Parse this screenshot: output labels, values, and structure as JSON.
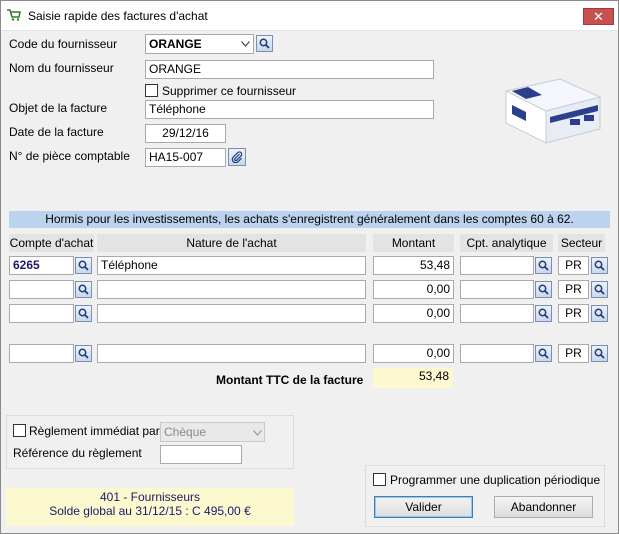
{
  "window": {
    "title": "Saisie rapide des factures d'achat",
    "close": "✕"
  },
  "form": {
    "supplier_code_label": "Code du fournisseur",
    "supplier_code_value": "ORANGE",
    "supplier_name_label": "Nom du fournisseur",
    "supplier_name_value": "ORANGE",
    "delete_supplier_label": "Supprimer ce fournisseur",
    "invoice_object_label": "Objet de la facture",
    "invoice_object_value": "Téléphone",
    "invoice_date_label": "Date de la facture",
    "invoice_date_value": "29/12/16",
    "piece_label": "N° de pièce comptable",
    "piece_value": "HA15-007"
  },
  "info_bar": "Hormis pour les investissements, les achats s'enregistrent généralement dans les comptes 60 à 62.",
  "table": {
    "headers": [
      "Compte d'achat",
      "Nature de l'achat",
      "Montant",
      "Cpt. analytique",
      "Secteur"
    ],
    "rows": [
      {
        "account": "6265",
        "nature": "Téléphone",
        "amount": "53,48",
        "analytic": "",
        "sector": "PR"
      },
      {
        "account": "",
        "nature": "",
        "amount": "0,00",
        "analytic": "",
        "sector": "PR"
      },
      {
        "account": "",
        "nature": "",
        "amount": "0,00",
        "analytic": "",
        "sector": "PR"
      },
      {
        "account": "",
        "nature": "",
        "amount": "0,00",
        "analytic": "",
        "sector": "PR"
      }
    ]
  },
  "total": {
    "label": "Montant  TTC de la facture",
    "value": "53,48"
  },
  "payment": {
    "immediate_label": "Règlement immédiat par",
    "method": "Chèque",
    "reference_label": "Référence du règlement",
    "reference_value": ""
  },
  "supplier_info": {
    "line1": "401 - Fournisseurs",
    "line2": "Solde global au 31/12/15 : C 495,00 €"
  },
  "duplication_label": "Programmer une duplication périodique",
  "buttons": {
    "validate": "Valider",
    "cancel": "Abandonner"
  }
}
